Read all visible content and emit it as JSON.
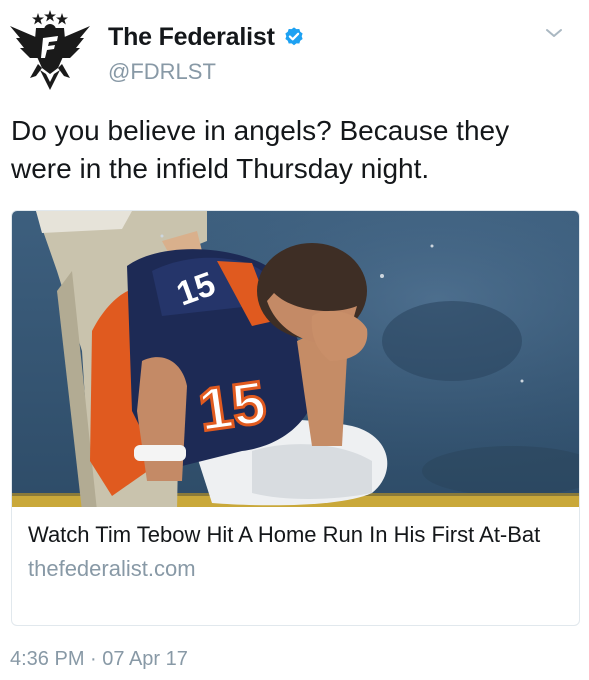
{
  "author": {
    "display_name": "The Federalist",
    "handle": "@FDRLST",
    "verified": true,
    "avatar_icon": "federalist-eagle-logo"
  },
  "menu": {
    "icon": "chevron-down-icon"
  },
  "tweet": {
    "text": "Do you believe in angels? Because they were in the infield Thursday night."
  },
  "card": {
    "image_description_icon": "photo-football-player-kneeling",
    "title": "Watch Tim Tebow Hit A Home Run In His First At-Bat",
    "domain": "thefederalist.com"
  },
  "meta": {
    "timestamp": "4:36 PM · 07 Apr 17"
  },
  "colors": {
    "text_primary": "#14171a",
    "text_secondary": "#8899a6",
    "verified_blue": "#1da1f2",
    "card_border": "#e1e8ed"
  }
}
